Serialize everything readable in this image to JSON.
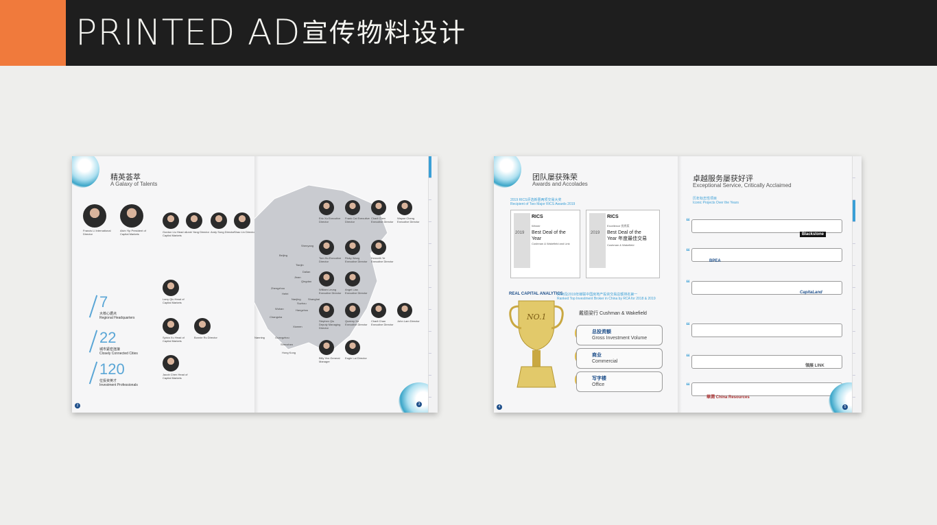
{
  "header": {
    "title_en": "PRINTED AD",
    "title_cn": "宣传物料设计"
  },
  "left_spread": {
    "title_cn": "精英荟萃",
    "title_en": "A Galaxy of Talents",
    "stats": [
      {
        "num": "7",
        "cn": "大核心据点",
        "en": "Regional Headquarters"
      },
      {
        "num": "22",
        "cn": "城市紧密连接",
        "en": "Closely Connected Cities"
      },
      {
        "num": "120",
        "cn": "位投资英才",
        "en": "Investment Professionals"
      }
    ],
    "cities": [
      "Shenyang",
      "Beijing",
      "Tianjin",
      "Dalian",
      "Jinan",
      "Qingdao",
      "Zhengzhou",
      "Hefei",
      "Nanjing",
      "Suzhou",
      "Shanghai",
      "Hangzhou",
      "Wuhan",
      "Chongqing",
      "Chengdu",
      "Xi'an",
      "Changsha",
      "Xiamen",
      "Guangzhou",
      "Shenzhen",
      "Hong Kong",
      "Nanning"
    ],
    "people": [
      {
        "name": "Francis Li",
        "role": "International Director"
      },
      {
        "name": "Alvin Yip",
        "role": "President of Capital Markets"
      },
      {
        "name": "Gordon Liu",
        "role": "Head of Capital Markets"
      },
      {
        "name": "Leah Yang",
        "role": "Director"
      },
      {
        "name": "Andy Song",
        "role": "Director"
      },
      {
        "name": "Shao Lin",
        "role": "Director"
      },
      {
        "name": "Larry Qiu",
        "role": "Head of Capital Markets"
      },
      {
        "name": "Sylvia Xu",
        "role": "Head of Capital Markets"
      },
      {
        "name": "Bonnie Ru",
        "role": "Director"
      },
      {
        "name": "Jacob Chen",
        "role": "Head of Capital Markets"
      },
      {
        "name": "Eric Xu",
        "role": "Executive Director"
      },
      {
        "name": "Frank Cai",
        "role": "Executive Director"
      },
      {
        "name": "Charli Chen",
        "role": "Executive Director"
      },
      {
        "name": "Wayne Cheng",
        "role": "Executive Director"
      },
      {
        "name": "Tom Hu",
        "role": "Executive Director"
      },
      {
        "name": "Ricky Wang",
        "role": "Executive Director"
      },
      {
        "name": "Kenneth Ye",
        "role": "Executive Director"
      },
      {
        "name": "William Leung",
        "role": "Executive Director"
      },
      {
        "name": "Angel Liao",
        "role": "Executive Director"
      },
      {
        "name": "Stephen Qiu",
        "role": "Deputy Managing Director"
      },
      {
        "name": "Queeny Xu",
        "role": "Executive Director"
      },
      {
        "name": "Charli Chan",
        "role": "Executive Director"
      },
      {
        "name": "John Lam",
        "role": "Director"
      },
      {
        "name": "Billy Yen",
        "role": "General Manager"
      },
      {
        "name": "Eagle Lai",
        "role": "Director"
      }
    ],
    "page_left": "2",
    "page_right": "3"
  },
  "right_spread": {
    "title_cn": "团队屡获殊荣",
    "title_en": "Awards and Accolades",
    "awards_heading_cn": "2019 RICS评选新晋两项交易大奖",
    "awards_heading_en": "Recipient of Two Major RICS Awards 2019",
    "awards": [
      {
        "label": "Winner",
        "title": "Best Deal of the Year",
        "sub": "Cushman & Wakefield and Link",
        "year": "2019"
      },
      {
        "label": "Excellence 优秀奖",
        "title": "Best Deal of the Year 年度最佳交易",
        "sub": "Cushman & Wakefield",
        "year": "2019"
      }
    ],
    "rca_cn": "2018及2019年蝉联中国房地产投资交易总额排名第一",
    "rca_en": "Ranked Top Investment Broker in China by RCA for 2018 & 2019",
    "rca_logo": "REAL CAPITAL ANALYTICS",
    "trophy_text": "NO.1",
    "company": "戴德梁行  Cushman & Wakefield",
    "categories": [
      {
        "cn": "总投资额",
        "en": "Gross Investment Volume"
      },
      {
        "cn": "商业",
        "en": "Commercial"
      },
      {
        "cn": "写字楼",
        "en": "Office"
      }
    ],
    "review_title_cn": "卓越服务屡获好评",
    "review_title_en": "Exceptional Service, Critically Acclaimed",
    "projects_cn": "历年标志性项目",
    "projects_en": "Iconic Projects Over the Years",
    "brands": [
      "Blackstone",
      "BPEA",
      "CapitaLand",
      "領展 LINK",
      "華潤 China Resources"
    ],
    "page_left": "4",
    "page_right": "5"
  }
}
